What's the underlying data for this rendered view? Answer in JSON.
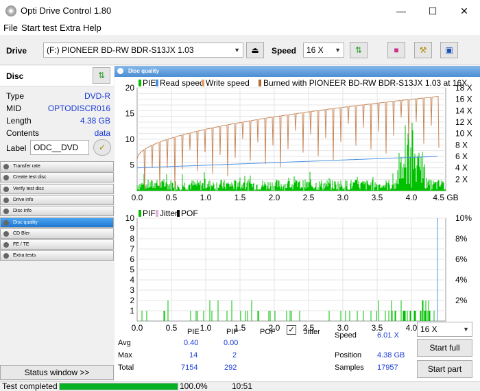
{
  "window": {
    "title": "Opti Drive Control 1.80"
  },
  "menu": [
    "File",
    "Start test",
    "Extra",
    "Help"
  ],
  "drive": {
    "label": "Drive",
    "selected": "(F:)   PIONEER BD-RW   BDR-S13JX 1.03",
    "speed_label": "Speed",
    "speed_value": "16 X"
  },
  "disc": {
    "title": "Disc",
    "rows": [
      {
        "k": "Type",
        "v": "DVD-R"
      },
      {
        "k": "MID",
        "v": "OPTODISCR016"
      },
      {
        "k": "Length",
        "v": "4.38 GB"
      },
      {
        "k": "Contents",
        "v": "data"
      }
    ],
    "label_key": "Label",
    "label_value": "ODC__DVD"
  },
  "nav": [
    "Transfer rate",
    "Create test disc",
    "Verify test disc",
    "Drive info",
    "Disc info",
    "Disc quality",
    "CD Bler",
    "FE / TE",
    "Extra tests"
  ],
  "nav_active": 5,
  "status_window": "Status window >>",
  "panel_title": "Disc quality",
  "legend1": {
    "pie": "PIE",
    "read": "Read speed",
    "write": "Write speed",
    "burned": "Burned with PIONEER BD-RW   BDR-S13JX 1.03 at 16X"
  },
  "legend2": {
    "pif": "PIF",
    "jitter": "Jitter",
    "pof": "POF"
  },
  "chart_data": [
    {
      "type": "bar",
      "x_label_unit": "GB",
      "x_ticks": [
        "0.0",
        "0.5",
        "1.0",
        "1.5",
        "2.0",
        "2.5",
        "3.0",
        "3.5",
        "4.0",
        "4.5"
      ],
      "y_left_ticks": [
        "5",
        "10",
        "15",
        "20"
      ],
      "y_right_ticks": [
        "2 X",
        "4 X",
        "6 X",
        "8 X",
        "10 X",
        "12 X",
        "14 X",
        "16 X",
        "18 X"
      ],
      "xlim": [
        0,
        4.5
      ],
      "ylim": [
        0,
        20
      ],
      "y_right_lim": [
        0,
        18
      ],
      "series": [
        {
          "name": "PIE",
          "color": "#00c000",
          "summary": {
            "avg": 0.4,
            "max": 14,
            "total": 7154
          }
        },
        {
          "name": "Read speed",
          "color": "#4a90e2",
          "values_start_end": [
            4.0,
            6.0
          ]
        },
        {
          "name": "Write speed",
          "color": "#c8875a",
          "values_start_end": [
            5.5,
            16.5
          ]
        }
      ]
    },
    {
      "type": "bar",
      "x_ticks": [
        "0.0",
        "0.5",
        "1.0",
        "1.5",
        "2.0",
        "2.5",
        "3.0",
        "3.5",
        "4.0",
        "4.5"
      ],
      "y_left_ticks": [
        "1",
        "2",
        "3",
        "4",
        "5",
        "6",
        "7",
        "8",
        "9",
        "10"
      ],
      "y_right_ticks": [
        "2%",
        "4%",
        "6%",
        "8%",
        "10%"
      ],
      "xlim": [
        0,
        4.5
      ],
      "ylim": [
        0,
        10
      ],
      "series": [
        {
          "name": "PIF",
          "color": "#00c000",
          "summary": {
            "avg": 0.0,
            "max": 2,
            "total": 292
          }
        }
      ]
    }
  ],
  "stats": {
    "headers": [
      "PIE",
      "PIF",
      "POF"
    ],
    "jitter": "Jitter",
    "rows": [
      {
        "label": "Avg",
        "pie": "0.40",
        "pif": "0.00"
      },
      {
        "label": "Max",
        "pie": "14",
        "pif": "2"
      },
      {
        "label": "Total",
        "pie": "7154",
        "pif": "292"
      }
    ],
    "speed_label": "Speed",
    "speed_value": "6.01 X",
    "position_label": "Position",
    "position_value": "4.38 GB",
    "samples_label": "Samples",
    "samples_value": "17957",
    "speed_select": "16 X",
    "start_full": "Start full",
    "start_part": "Start part"
  },
  "status": {
    "text": "Test completed",
    "progress": 100,
    "percent": "100.0%",
    "time": "10:51"
  }
}
